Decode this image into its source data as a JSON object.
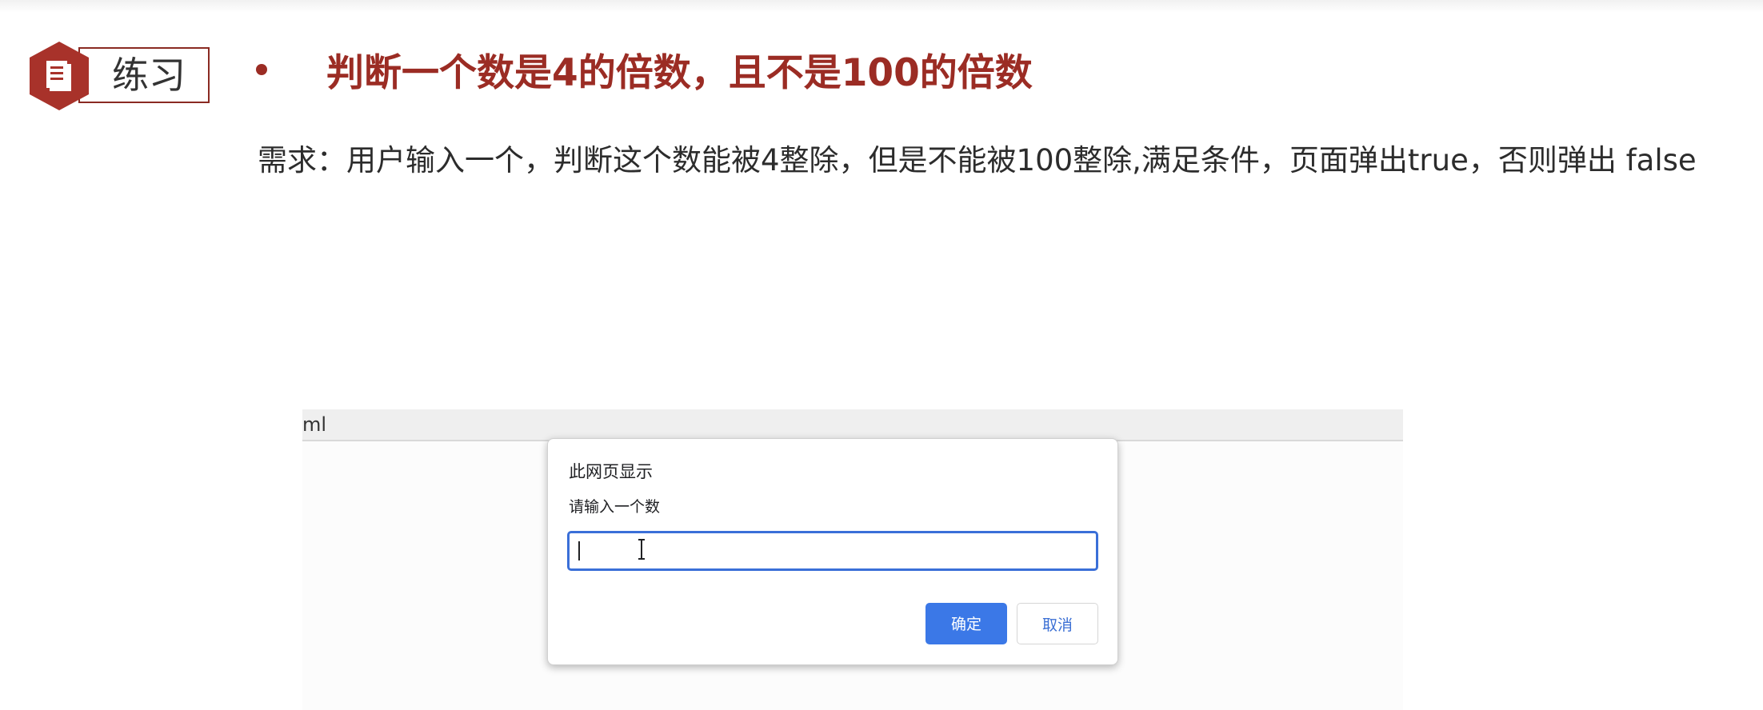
{
  "slide": {
    "badge_label": "练习",
    "title": "判断一个数是4的倍数，且不是100的倍数",
    "requirement": "需求：用户输入一个，判断这个数能被4整除，但是不能被100整除,满足条件，页面弹出true，否则弹出 false"
  },
  "browser": {
    "bar_text": "ml"
  },
  "dialog": {
    "title": "此网页显示",
    "message": "请输入一个数",
    "input_value": "",
    "ok_label": "确定",
    "cancel_label": "取消"
  },
  "icons": {
    "badge": "document-icon",
    "cursor": "text-cursor-icon"
  },
  "colors": {
    "accent": "#9b2c24",
    "badge_hex": "#a8322a",
    "input_focus": "#3a6fd8",
    "ok_button": "#3b78e7"
  }
}
